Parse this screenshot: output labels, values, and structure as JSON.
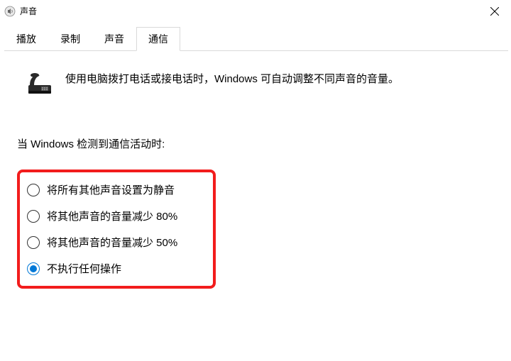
{
  "window": {
    "title": "声音"
  },
  "tabs": [
    {
      "label": "播放",
      "active": false
    },
    {
      "label": "录制",
      "active": false
    },
    {
      "label": "声音",
      "active": false
    },
    {
      "label": "通信",
      "active": true
    }
  ],
  "description": "使用电脑拨打电话或接电话时，Windows 可自动调整不同声音的音量。",
  "section_label": "当 Windows 检测到通信活动时:",
  "radio_options": [
    {
      "label": "将所有其他声音设置为静音",
      "checked": false
    },
    {
      "label": "将其他声音的音量减少 80%",
      "checked": false
    },
    {
      "label": "将其他声音的音量减少 50%",
      "checked": false
    },
    {
      "label": "不执行任何操作",
      "checked": true
    }
  ]
}
